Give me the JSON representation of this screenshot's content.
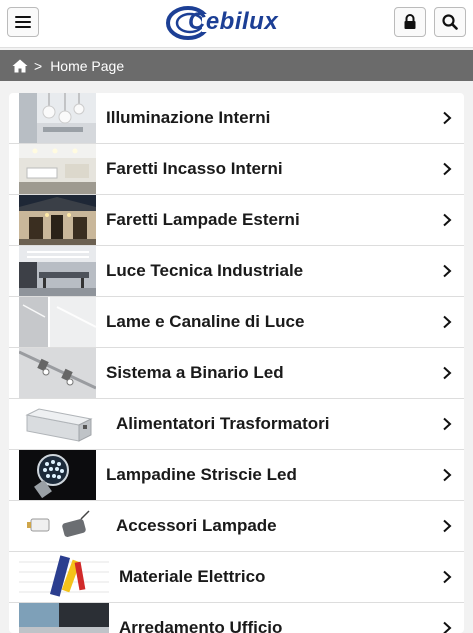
{
  "header": {
    "logo_text": "Cebilux",
    "brand_color": "#1c3f95",
    "menu_icon": "hamburger-menu-icon",
    "lock_icon": "lock-icon",
    "search_icon": "search-icon"
  },
  "breadcrumb": {
    "home_icon": "home-icon",
    "separator": ">",
    "current": "Home Page"
  },
  "categories": [
    {
      "label": "Illuminazione Interni",
      "image": "interior-lighting-photo"
    },
    {
      "label": "Faretti Incasso Interni",
      "image": "recessed-spotlights-photo"
    },
    {
      "label": "Faretti Lampade Esterni",
      "image": "outdoor-lamps-photo"
    },
    {
      "label": "Luce Tecnica Industriale",
      "image": "industrial-lighting-photo"
    },
    {
      "label": "Lame e Canaline di Luce",
      "image": "light-channels-photo"
    },
    {
      "label": "Sistema a Binario Led",
      "image": "led-track-system-photo"
    },
    {
      "label": "Alimentatori Trasformatori",
      "image": "power-supply-photo"
    },
    {
      "label": "Lampadine Striscie Led",
      "image": "led-bulb-photo"
    },
    {
      "label": "Accessori Lampade",
      "image": "lamp-accessories-photo"
    },
    {
      "label": "Materiale Elettrico",
      "image": "electrical-material-photo"
    },
    {
      "label": "Arredamento Ufficio",
      "image": "office-furniture-photo"
    }
  ]
}
